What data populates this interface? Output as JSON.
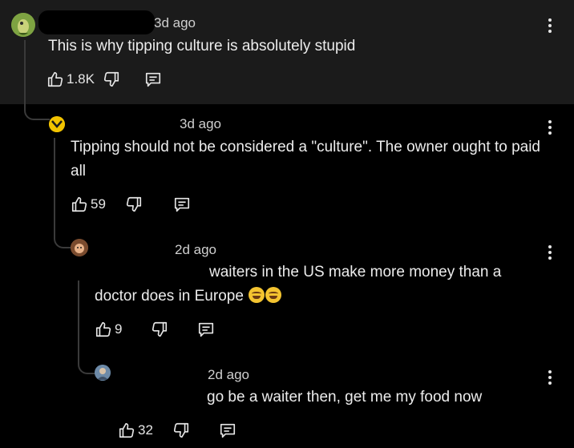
{
  "comments": [
    {
      "timestamp": "3d ago",
      "text": "This is why tipping culture is absolutely stupid",
      "likes": "1.8K"
    },
    {
      "timestamp": "3d ago",
      "text": "Tipping should not be considered a \"culture\". The owner ought to paid all",
      "likes": "59"
    },
    {
      "timestamp": "2d ago",
      "text_line1": "waiters in the US make more money than a",
      "text_line2": "doctor does in Europe",
      "emoji": "rolling-on-floor-laughing-emoji",
      "likes": "9"
    },
    {
      "timestamp": "2d ago",
      "text": "go be a waiter then, get me my food now",
      "likes": "32"
    }
  ],
  "icons": {
    "like": "thumbs-up-icon",
    "dislike": "thumbs-down-icon",
    "reply": "reply-icon",
    "more": "more-options-icon"
  },
  "colors": {
    "background": "#000000",
    "top_comment_background": "#1b1b1b",
    "text": "#ececec"
  }
}
